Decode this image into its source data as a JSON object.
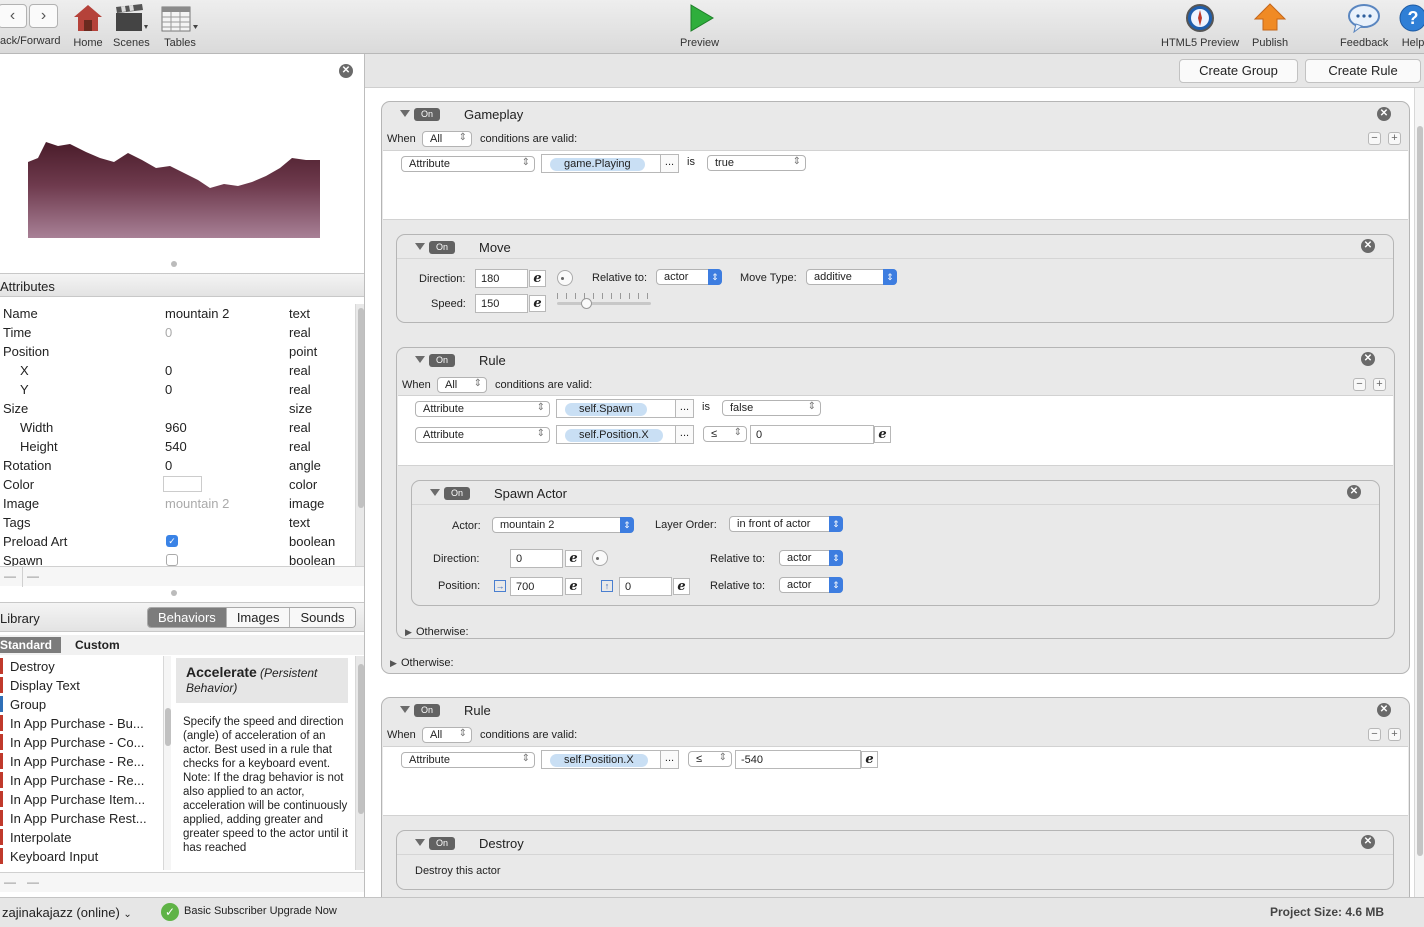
{
  "toolbar": {
    "back_forward_label": "ack/Forward",
    "home_label": "Home",
    "scenes_label": "Scenes",
    "tables_label": "Tables",
    "preview_label": "Preview",
    "html5_preview_label": "HTML5 Preview",
    "publish_label": "Publish",
    "feedback_label": "Feedback",
    "help_label": "Help"
  },
  "attributes": {
    "header": "Attributes",
    "rows": [
      {
        "name": "Name",
        "value": "mountain 2",
        "type": "text"
      },
      {
        "name": "Time",
        "value": "0",
        "type": "real"
      },
      {
        "name": "Position",
        "value": "",
        "type": "point"
      },
      {
        "name": "X",
        "value": "0",
        "type": "real"
      },
      {
        "name": "Y",
        "value": "0",
        "type": "real"
      },
      {
        "name": "Size",
        "value": "",
        "type": "size"
      },
      {
        "name": "Width",
        "value": "960",
        "type": "real"
      },
      {
        "name": "Height",
        "value": "540",
        "type": "real"
      },
      {
        "name": "Rotation",
        "value": "0",
        "type": "angle"
      },
      {
        "name": "Color",
        "value": "",
        "type": "color"
      },
      {
        "name": "Image",
        "value": "mountain 2",
        "type": "image"
      },
      {
        "name": "Tags",
        "value": "",
        "type": "text"
      },
      {
        "name": "Preload Art",
        "value": "",
        "type": "boolean"
      },
      {
        "name": "Spawn",
        "value": "",
        "type": "boolean"
      }
    ],
    "preload_art_checked": true,
    "spawn_checked": false
  },
  "library": {
    "header": "Library",
    "tabs": [
      "Behaviors",
      "Images",
      "Sounds"
    ],
    "active_tab": "Behaviors",
    "subtabs": [
      "Standard",
      "Custom"
    ],
    "active_subtab": "Standard",
    "items": [
      {
        "label": "Destroy",
        "color": "#c0392b"
      },
      {
        "label": "Display Text",
        "color": "#c0392b"
      },
      {
        "label": "Group",
        "color": "#2e6fb7"
      },
      {
        "label": "In App Purchase - Bu...",
        "color": "#c0392b"
      },
      {
        "label": "In App Purchase - Co...",
        "color": "#c0392b"
      },
      {
        "label": "In App Purchase - Re...",
        "color": "#c0392b"
      },
      {
        "label": "In App Purchase - Re...",
        "color": "#c0392b"
      },
      {
        "label": "In App Purchase Item...",
        "color": "#c0392b"
      },
      {
        "label": "In App Purchase Rest...",
        "color": "#c0392b"
      },
      {
        "label": "Interpolate",
        "color": "#c0392b"
      },
      {
        "label": "Keyboard Input",
        "color": "#c0392b"
      }
    ],
    "desc_title": "Accelerate",
    "desc_subtitle": "(Persistent Behavior)",
    "desc_body": "Specify the speed and direction (angle) of acceleration of an actor. Best used in a rule that checks for a keyboard event. Note: If the drag behavior is not also applied to an actor, acceleration will be continuously applied, adding greater and greater speed to the actor until it has reached"
  },
  "editor": {
    "create_group_label": "Create Group",
    "create_rule_label": "Create Rule",
    "on_label": "On",
    "when_label": "When",
    "all_label": "All",
    "conditions_label": "conditions are valid:",
    "otherwise_label": "Otherwise:",
    "attribute_label": "Attribute",
    "is_label": "is",
    "dots_label": "...",
    "gameplay": {
      "title": "Gameplay",
      "cond_attr": "game.Playing",
      "cond_value": "true"
    },
    "move": {
      "title": "Move",
      "direction_label": "Direction:",
      "direction_value": "180",
      "relative_label": "Relative to:",
      "relative_value": "actor",
      "move_type_label": "Move Type:",
      "move_type_value": "additive",
      "speed_label": "Speed:",
      "speed_value": "150"
    },
    "rule1": {
      "title": "Rule",
      "cond1_attr": "self.Spawn",
      "cond1_value": "false",
      "cond2_attr": "self.Position.X",
      "cond2_op": "≤",
      "cond2_value": "0"
    },
    "spawn": {
      "title": "Spawn Actor",
      "actor_label": "Actor:",
      "actor_value": "mountain 2",
      "layer_label": "Layer Order:",
      "layer_value": "in front of actor",
      "direction_label": "Direction:",
      "direction_value": "0",
      "relative_label": "Relative to:",
      "relative_dir_value": "actor",
      "position_label": "Position:",
      "pos_x": "700",
      "pos_y": "0",
      "relative_pos_value": "actor"
    },
    "rule2": {
      "title": "Rule",
      "cond_attr": "self.Position.X",
      "cond_op": "≤",
      "cond_value": "-540"
    },
    "destroy": {
      "title": "Destroy",
      "body": "Destroy this actor"
    }
  },
  "status": {
    "user": "zajinakajazz (online)",
    "upgrade": "Basic Subscriber Upgrade Now",
    "project_size": "Project Size: 4.6 MB"
  }
}
